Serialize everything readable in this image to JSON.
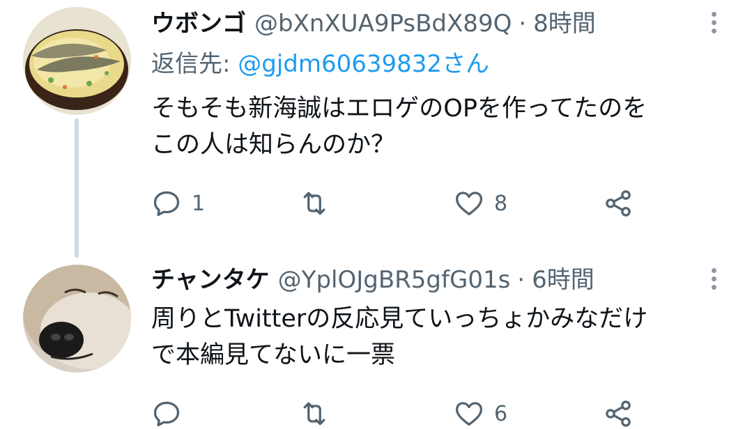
{
  "tweets": [
    {
      "name": "ウボンゴ",
      "handle": "@bXnXUA9PsBdX89Q",
      "separator": "·",
      "time": "8時間",
      "reply_label": "返信先: ",
      "reply_mention": "@gjdm60639832",
      "reply_suffix": "さん",
      "text_line1": "そもそも新海誠はエロゲのOPを作ってたのを",
      "text_line2": "この人は知らんのか？",
      "reply_count": "1",
      "retweet_count": "",
      "like_count": "8"
    },
    {
      "name": "チャンタケ",
      "handle": "@YplOJgBR5gfG01s",
      "separator": "·",
      "time": "6時間",
      "text_line1": "周りとTwitterの反応見ていっちょかみなだけ",
      "text_line2": "で本編見てないに一票",
      "reply_count": "",
      "retweet_count": "",
      "like_count": "6"
    }
  ],
  "colors": {
    "text": "#0f1419",
    "secondary": "#536471",
    "link": "#1d9bf0",
    "thread_line": "#cfd9de"
  },
  "icons": [
    "reply-icon",
    "retweet-icon",
    "like-icon",
    "share-icon",
    "more-icon"
  ]
}
